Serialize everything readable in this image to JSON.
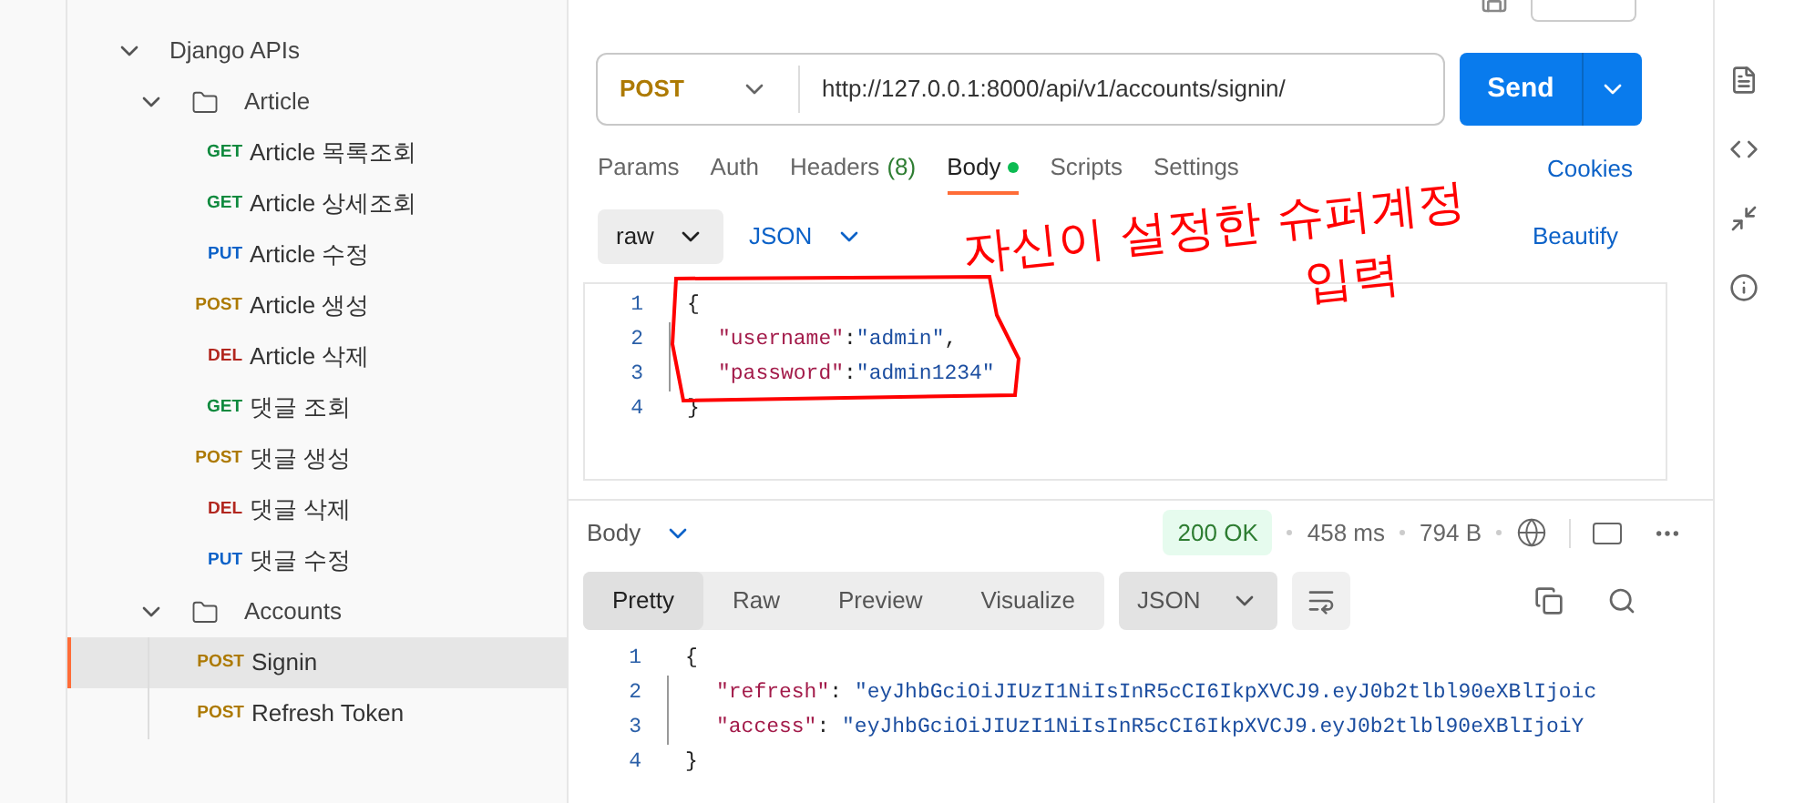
{
  "sidebar": {
    "collection": {
      "name": "Django APIs",
      "expanded": true,
      "children": [
        {
          "name": "Article",
          "expanded": true,
          "children": [
            {
              "method": "GET",
              "name": "Article 목록조회",
              "selected": false
            },
            {
              "method": "GET",
              "name": "Article 상세조회",
              "selected": false
            },
            {
              "method": "PUT",
              "name": "Article 수정",
              "selected": false
            },
            {
              "method": "POST",
              "name": "Article 생성",
              "selected": false
            },
            {
              "method": "DEL",
              "name": "Article 삭제",
              "selected": false
            },
            {
              "method": "GET",
              "name": "댓글 조회",
              "selected": false
            },
            {
              "method": "POST",
              "name": "댓글 생성",
              "selected": false
            },
            {
              "method": "DEL",
              "name": "댓글 삭제",
              "selected": false
            },
            {
              "method": "PUT",
              "name": "댓글 수정",
              "selected": false
            }
          ]
        },
        {
          "name": "Accounts",
          "expanded": true,
          "children": [
            {
              "method": "POST",
              "name": "Signin",
              "selected": true
            },
            {
              "method": "POST",
              "name": "Refresh Token",
              "selected": false
            }
          ]
        }
      ]
    }
  },
  "request": {
    "method": "POST",
    "url": "http://127.0.0.1:8000/api/v1/accounts/signin/",
    "send": "Send",
    "tabs": [
      {
        "label": "Params",
        "selected": false
      },
      {
        "label": "Auth",
        "selected": false
      },
      {
        "label": "Headers",
        "count": "(8)",
        "selected": false
      },
      {
        "label": "Body",
        "dot": true,
        "selected": true
      },
      {
        "label": "Scripts",
        "selected": false
      },
      {
        "label": "Settings",
        "selected": false
      }
    ],
    "cookies": "Cookies",
    "body_mode": "raw",
    "body_format": "JSON",
    "beautify": "Beautify",
    "code": [
      {
        "no": "1",
        "parts": [
          {
            "kind": "punct",
            "text": "{"
          }
        ]
      },
      {
        "no": "2",
        "parts": [
          {
            "kind": "key",
            "text": "\"username\""
          },
          {
            "kind": "punct",
            "text": ":"
          },
          {
            "kind": "string",
            "text": "\"admin\""
          },
          {
            "kind": "punct",
            "text": ","
          }
        ]
      },
      {
        "no": "3",
        "parts": [
          {
            "kind": "key",
            "text": "\"password\""
          },
          {
            "kind": "punct",
            "text": ":"
          },
          {
            "kind": "string",
            "text": "\"admin1234\""
          }
        ]
      },
      {
        "no": "4",
        "parts": [
          {
            "kind": "punct",
            "text": "}"
          }
        ]
      }
    ]
  },
  "annotation": {
    "lines": [
      "자신이 설정한 슈퍼계정",
      "입력"
    ]
  },
  "response": {
    "label": "Body",
    "status": "200 OK",
    "time": "458 ms",
    "size": "794 B",
    "tabs": [
      {
        "label": "Pretty",
        "selected": true
      },
      {
        "label": "Raw",
        "selected": false
      },
      {
        "label": "Preview",
        "selected": false
      },
      {
        "label": "Visualize",
        "selected": false
      }
    ],
    "format": "JSON",
    "code": [
      {
        "no": "1",
        "parts": [
          {
            "kind": "punct",
            "text": "{"
          }
        ]
      },
      {
        "no": "2",
        "parts": [
          {
            "kind": "key",
            "text": "\"refresh\""
          },
          {
            "kind": "punct",
            "text": ": "
          },
          {
            "kind": "string",
            "text": "\"eyJhbGciOiJIUzI1NiIsInR5cCI6IkpXVCJ9.eyJ0b2tlbl90eXBlIjoic"
          }
        ]
      },
      {
        "no": "3",
        "parts": [
          {
            "kind": "key",
            "text": "\"access\""
          },
          {
            "kind": "punct",
            "text": ": "
          },
          {
            "kind": "string",
            "text": "\"eyJhbGciOiJIUzI1NiIsInR5cCI6IkpXVCJ9.eyJ0b2tlbl90eXBlIjoiY"
          }
        ]
      },
      {
        "no": "4",
        "parts": [
          {
            "kind": "punct",
            "text": "}"
          }
        ]
      }
    ]
  }
}
